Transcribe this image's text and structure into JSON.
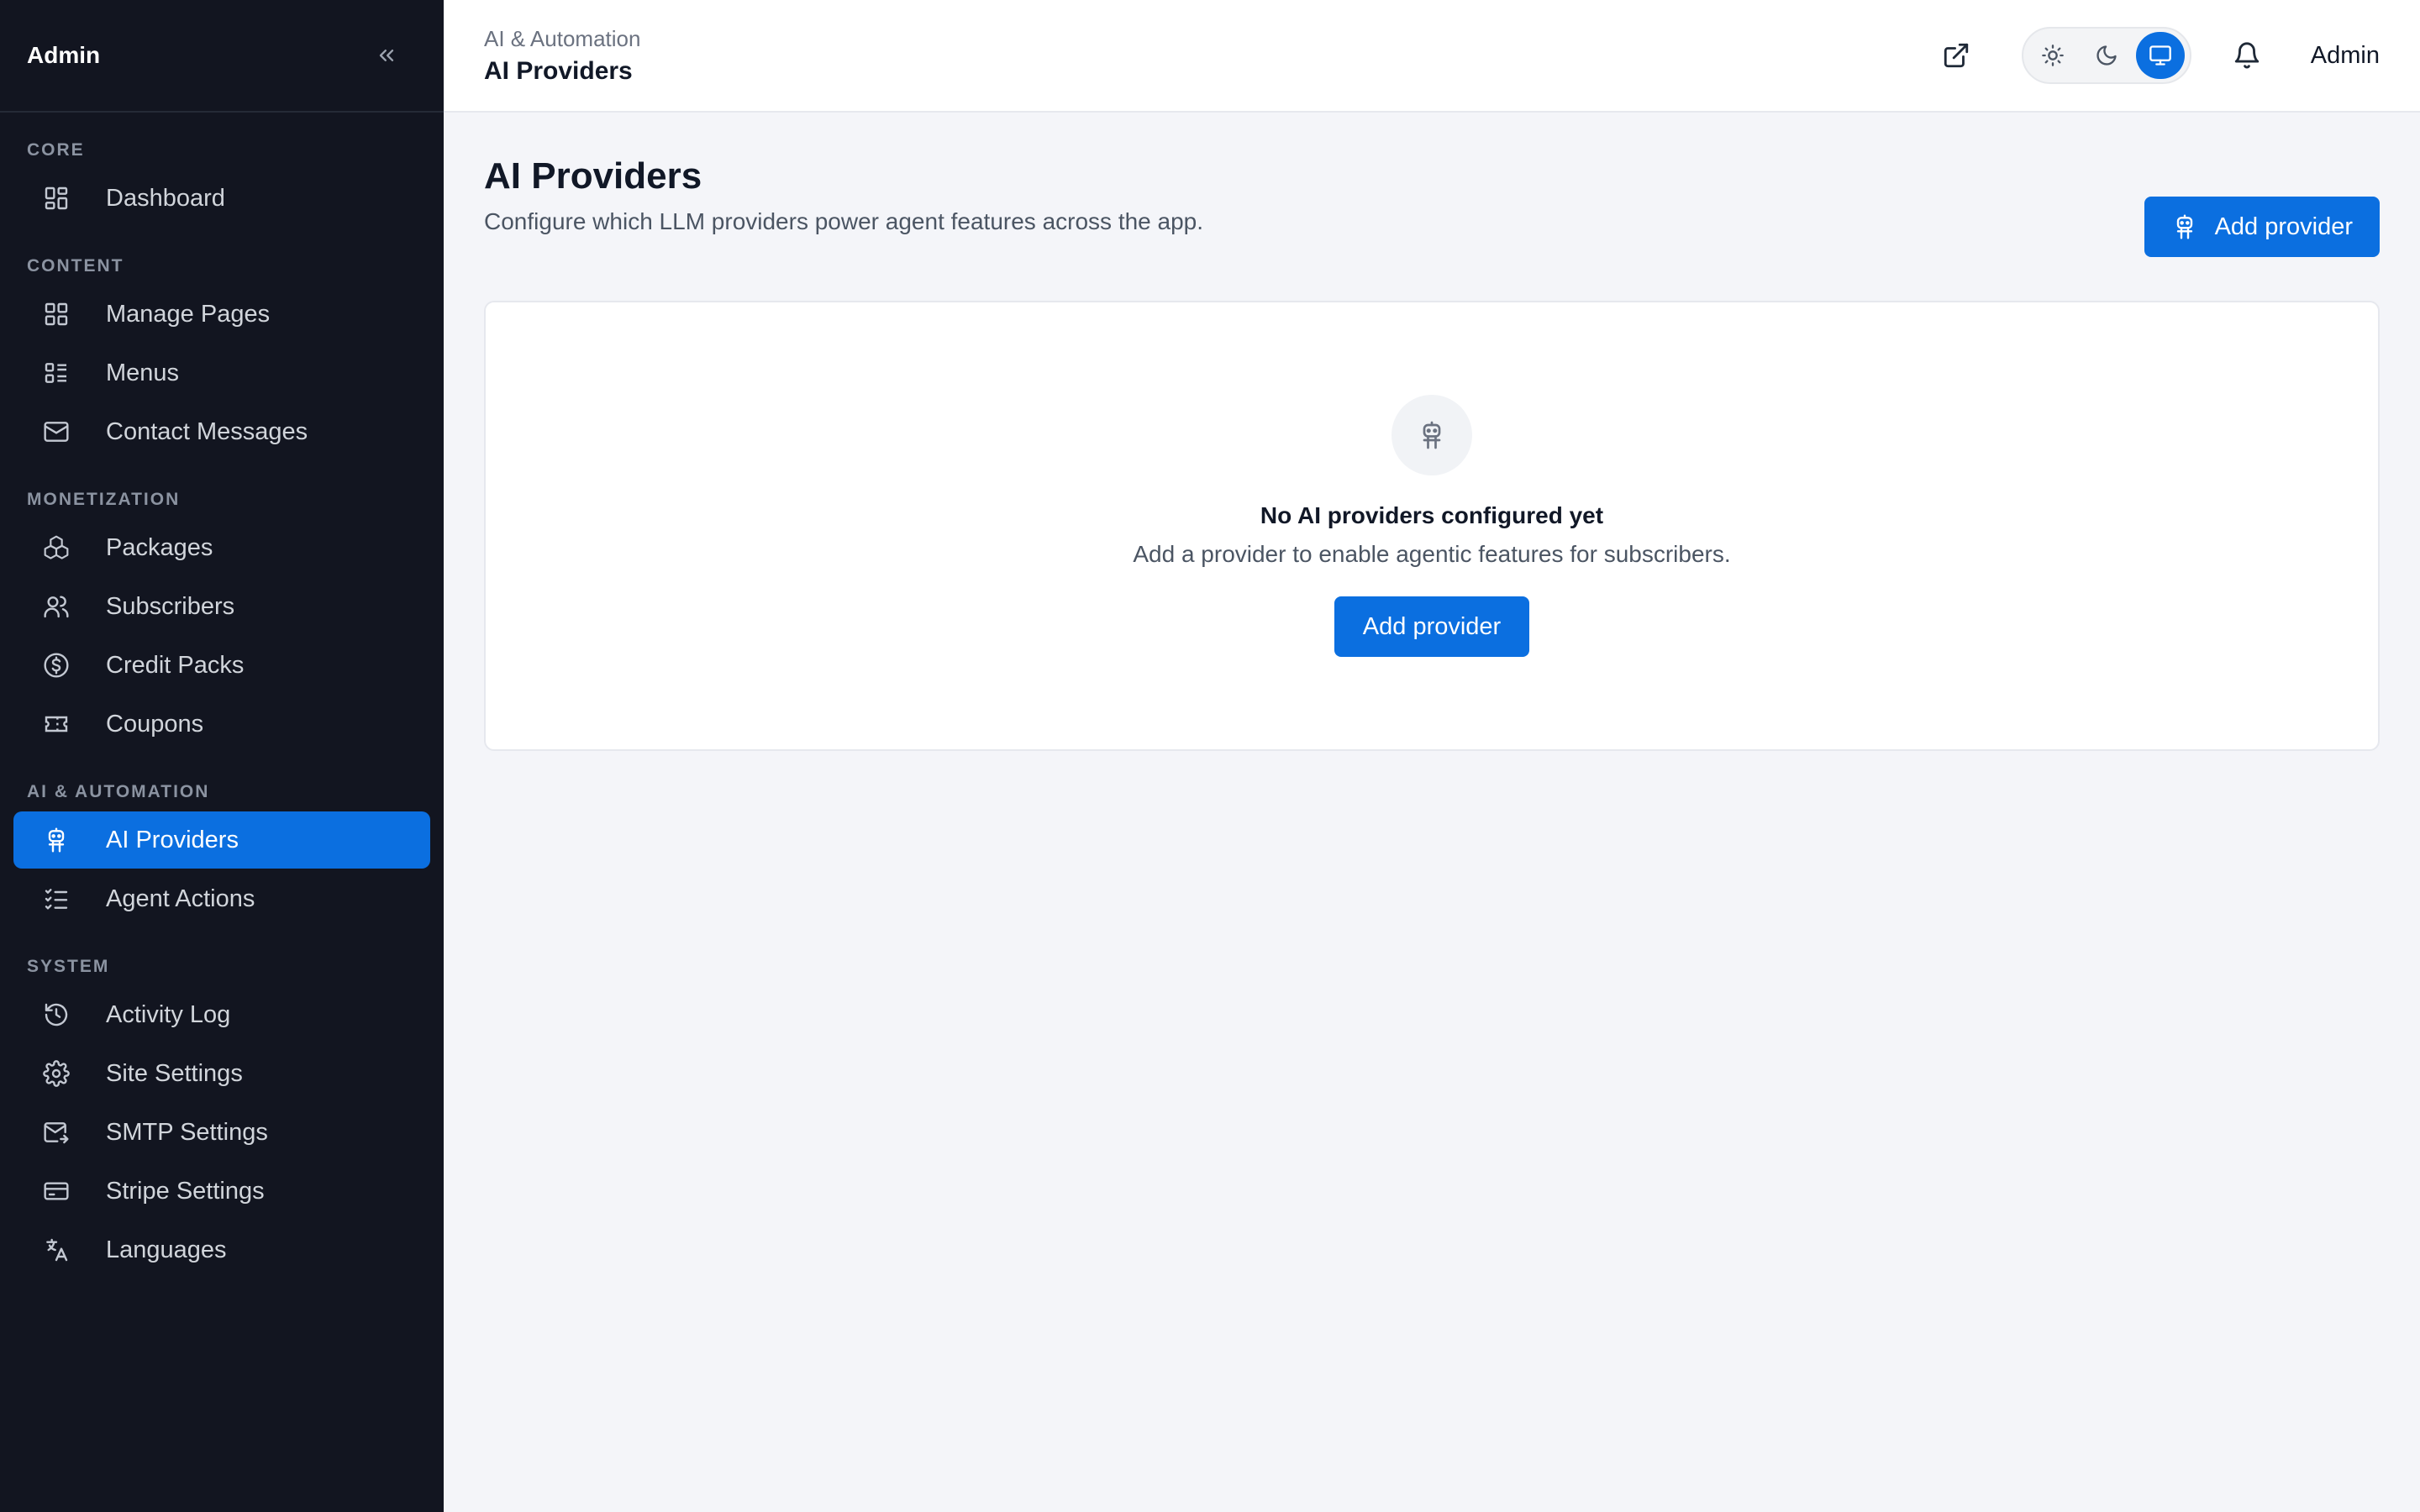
{
  "sidebar": {
    "brand": "Admin",
    "sections": [
      {
        "label": "CORE",
        "items": [
          {
            "label": "Dashboard",
            "icon": "dashboard-icon"
          }
        ]
      },
      {
        "label": "CONTENT",
        "items": [
          {
            "label": "Manage Pages",
            "icon": "grid-icon"
          },
          {
            "label": "Menus",
            "icon": "menu-list-icon"
          },
          {
            "label": "Contact Messages",
            "icon": "mail-icon"
          }
        ]
      },
      {
        "label": "MONETIZATION",
        "items": [
          {
            "label": "Packages",
            "icon": "boxes-icon"
          },
          {
            "label": "Subscribers",
            "icon": "users-icon"
          },
          {
            "label": "Credit Packs",
            "icon": "dollar-circle-icon"
          },
          {
            "label": "Coupons",
            "icon": "ticket-icon"
          }
        ]
      },
      {
        "label": "AI & AUTOMATION",
        "items": [
          {
            "label": "AI Providers",
            "icon": "robot-icon",
            "active": true
          },
          {
            "label": "Agent Actions",
            "icon": "checklist-icon"
          }
        ]
      },
      {
        "label": "SYSTEM",
        "items": [
          {
            "label": "Activity Log",
            "icon": "history-icon"
          },
          {
            "label": "Site Settings",
            "icon": "gear-icon"
          },
          {
            "label": "SMTP Settings",
            "icon": "mail-send-icon"
          },
          {
            "label": "Stripe Settings",
            "icon": "credit-card-icon"
          },
          {
            "label": "Languages",
            "icon": "translate-icon"
          }
        ]
      }
    ]
  },
  "topbar": {
    "breadcrumb_parent": "AI & Automation",
    "breadcrumb_current": "AI Providers",
    "user": "Admin",
    "theme_active": "system"
  },
  "page": {
    "title": "AI Providers",
    "subtitle": "Configure which LLM providers power agent features across the app.",
    "add_button": "Add provider"
  },
  "empty_state": {
    "title": "No AI providers configured yet",
    "description": "Add a provider to enable agentic features for subscribers.",
    "button": "Add provider"
  },
  "colors": {
    "accent": "#0b6fe0",
    "sidebar_bg": "#121520",
    "page_bg": "#f4f5f9"
  }
}
